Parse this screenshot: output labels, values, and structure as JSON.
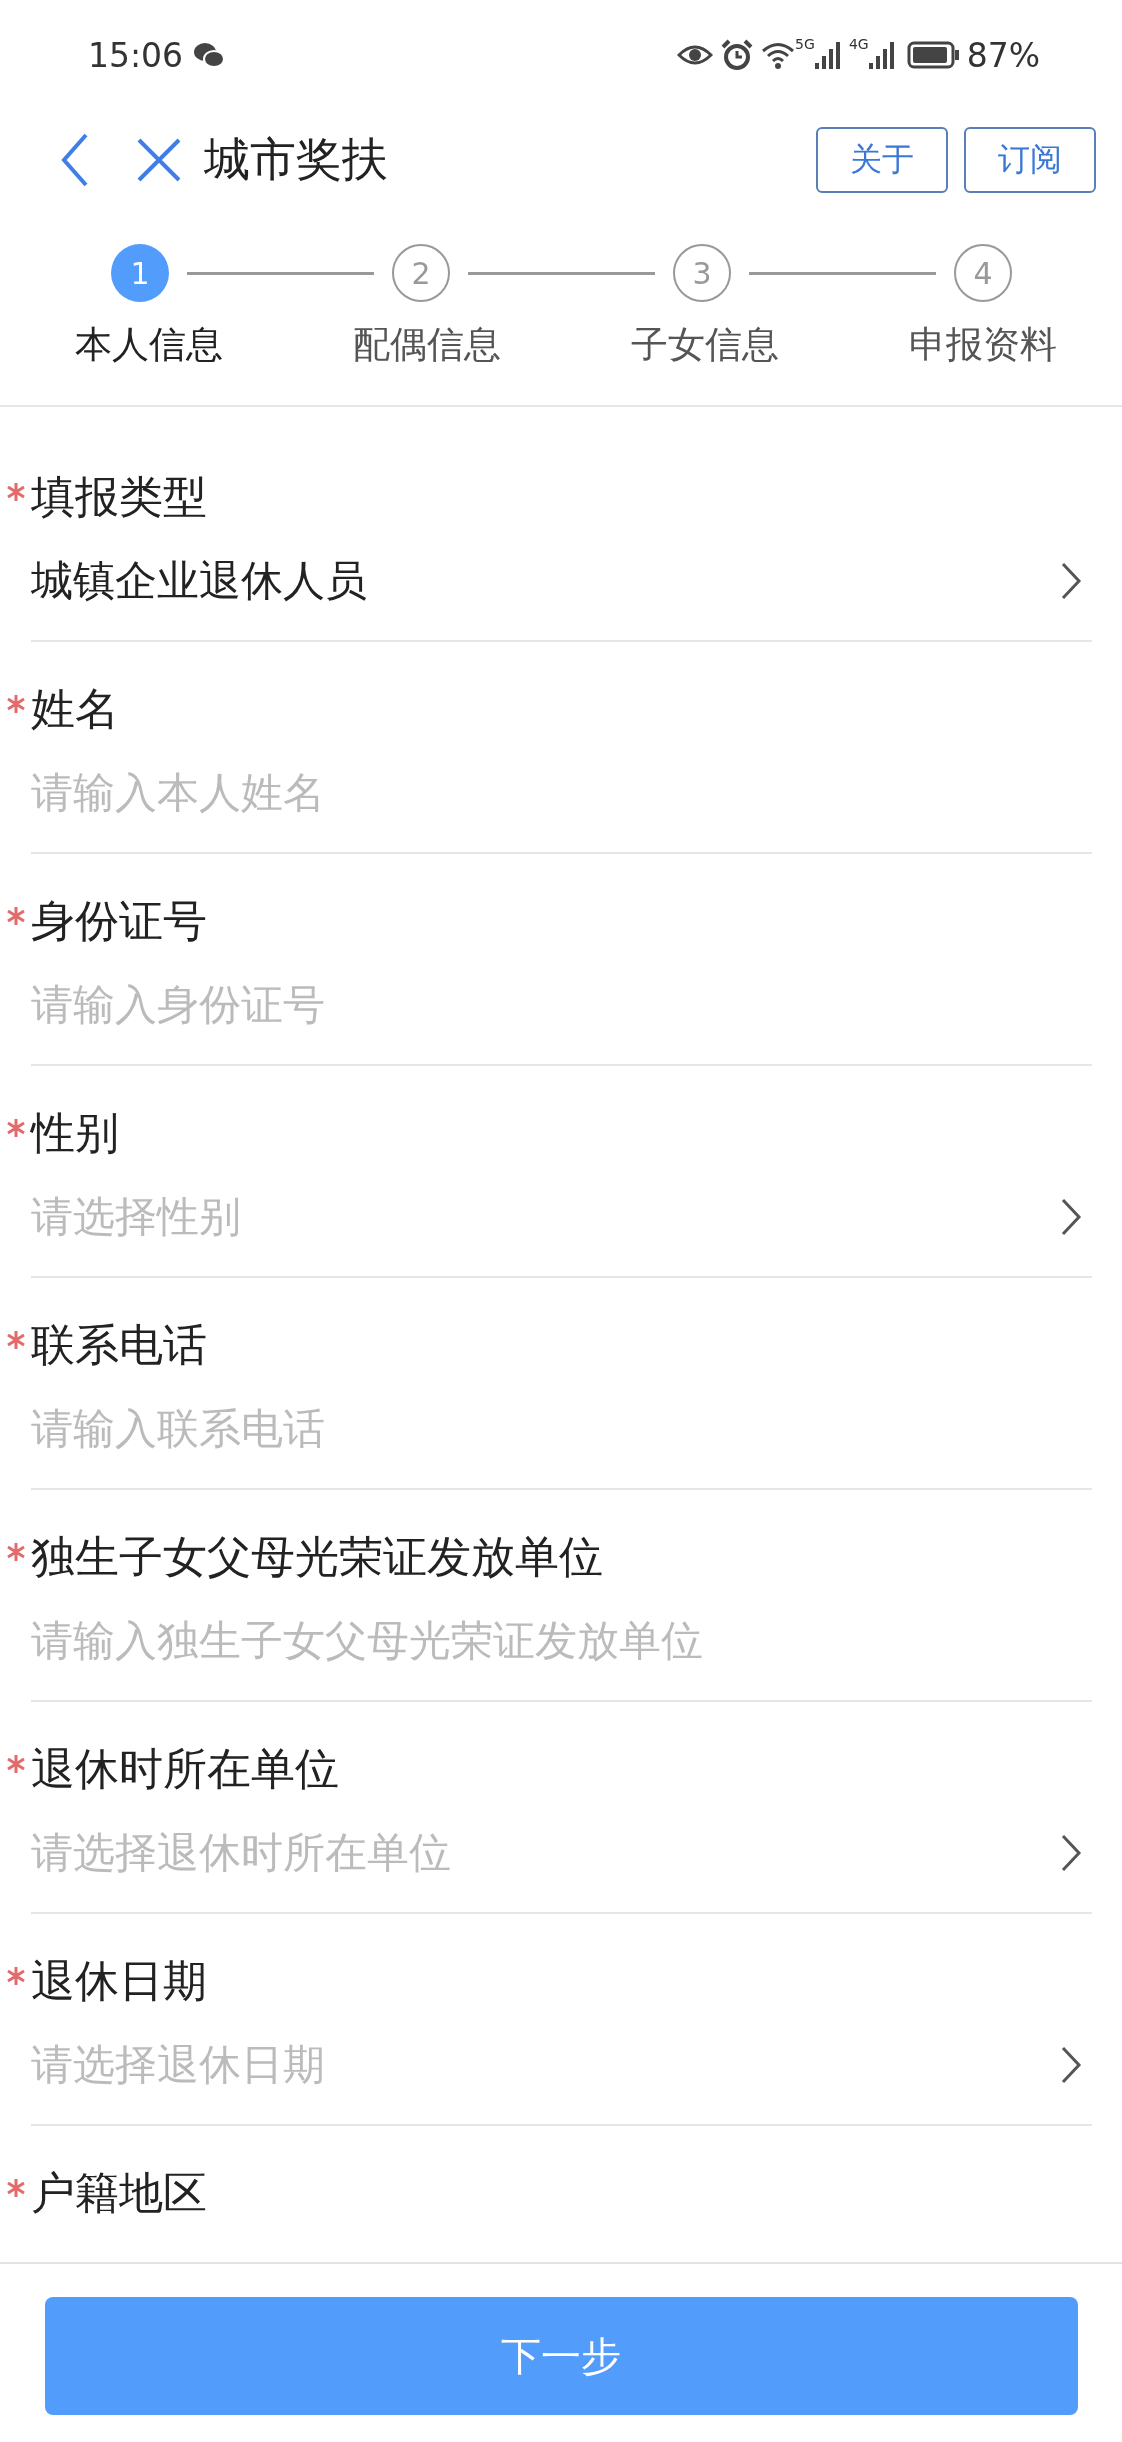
{
  "status_bar": {
    "time": "15:06",
    "network_5g": "5G",
    "network_4g": "4G",
    "battery": "87%"
  },
  "header": {
    "title": "城市奖扶",
    "buttons": [
      "关于",
      "订阅"
    ]
  },
  "steps": [
    {
      "number": "1",
      "label": "本人信息",
      "selected": true
    },
    {
      "number": "2",
      "label": "配偶信息",
      "selected": false
    },
    {
      "number": "3",
      "label": "子女信息",
      "selected": false
    },
    {
      "number": "4",
      "label": "申报资料",
      "selected": false
    }
  ],
  "fields": [
    {
      "kind": "select",
      "label": "填报类型",
      "required": true,
      "value": "城镇企业退休人员"
    },
    {
      "kind": "input",
      "label": "姓名",
      "required": true,
      "placeholder": "请输入本人姓名"
    },
    {
      "kind": "input",
      "label": "身份证号",
      "required": true,
      "placeholder": "请输入身份证号"
    },
    {
      "kind": "select",
      "label": "性别",
      "required": true,
      "placeholder": "请选择性别"
    },
    {
      "kind": "input",
      "label": "联系电话",
      "required": true,
      "placeholder": "请输入联系电话"
    },
    {
      "kind": "input",
      "label": "独生子女父母光荣证发放单位",
      "required": true,
      "placeholder": "请输入独生子女父母光荣证发放单位"
    },
    {
      "kind": "select",
      "label": "退休时所在单位",
      "required": true,
      "placeholder": "请选择退休时所在单位"
    },
    {
      "kind": "select",
      "label": "退休日期",
      "required": true,
      "placeholder": "请选择退休日期"
    },
    {
      "kind": "select",
      "label": "户籍地区",
      "required": true
    }
  ],
  "footer": {
    "button": "下一步"
  }
}
